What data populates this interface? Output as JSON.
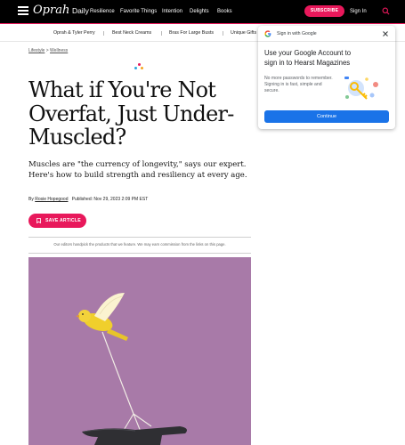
{
  "header": {
    "logo_script": "Oprah",
    "logo_daily": "Daily",
    "nav": [
      "Resilience",
      "Favorite Things",
      "Intention",
      "Delights",
      "Books"
    ],
    "subscribe_label": "SUBSCRIBE",
    "signin_label": "Sign In"
  },
  "trending": [
    "Oprah & Tyler Perry",
    "Best Neck Creams",
    "Bras For Large Busts",
    "Unique Gifts"
  ],
  "article": {
    "breadcrumbs": [
      "Lifestyle",
      "Wellness"
    ],
    "breadcrumb_sep": ">",
    "headline": "What if You're Not Overfat, Just Under-Muscled?",
    "dek": "Muscles are \"the currency of longevity,\" says our expert. Here's how to build strength and resiliency at every age.",
    "byline_prefix": "By",
    "author": "Rosie Hopegood",
    "published": "Published: Nov 29, 2023 2:09 PM EST",
    "save_label": "SAVE ARTICLE",
    "disclosure": "Our editors handpick the products that we feature. We may earn commission from the links on this page."
  },
  "google_prompt": {
    "title": "Sign in with Google",
    "heading": "Use your Google Account to sign in to Hearst Magazines",
    "subtext": "No more passwords to remember. Signing in is fast, simple and secure.",
    "continue_label": "Continue"
  },
  "colors": {
    "brand_pink": "#e8185b",
    "google_blue": "#1a73e8",
    "hero_background": "#a87aa8"
  }
}
